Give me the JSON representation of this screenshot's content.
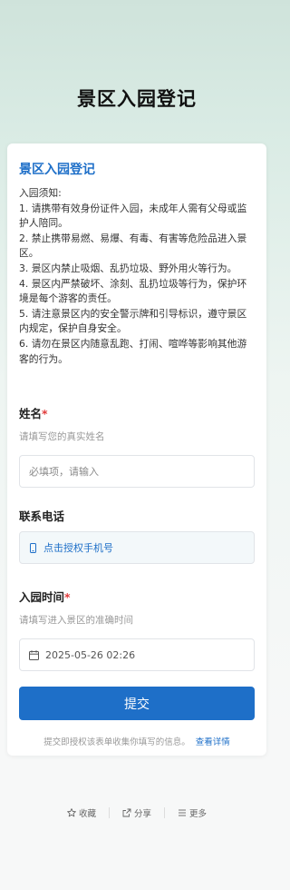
{
  "page_title": "景区入园登记",
  "card": {
    "title": "景区入园登记",
    "notice_heading": "入园须知:",
    "notice_items": [
      "1. 请携带有效身份证件入园，未成年人需有父母或监护人陪同。",
      "2. 禁止携带易燃、易爆、有毒、有害等危险品进入景区。",
      "3. 景区内禁止吸烟、乱扔垃圾、野外用火等行为。",
      "4. 景区内严禁破坏、涂刻、乱扔垃圾等行为，保护环境是每个游客的责任。",
      "5. 请注意景区内的安全警示牌和引导标识，遵守景区内规定，保护自身安全。",
      "6. 请勿在景区内随意乱跑、打闹、喧哗等影响其他游客的行为。"
    ]
  },
  "form": {
    "name": {
      "label": "姓名",
      "required_mark": "*",
      "description": "请填写您的真实姓名",
      "placeholder": "必填项，请输入",
      "value": ""
    },
    "phone": {
      "label": "联系电话",
      "button_label": "点击授权手机号",
      "icon": "phone-icon"
    },
    "entry_time": {
      "label": "入园时间",
      "required_mark": "*",
      "description": "请填写进入景区的准确时间",
      "value": "2025-05-26 02:26",
      "icon": "calendar-icon"
    },
    "submit_label": "提交",
    "consent_text": "提交即授权该表单收集你填写的信息。",
    "consent_link": "查看详情"
  },
  "footer": {
    "favorite_label": "收藏",
    "share_label": "分享",
    "more_label": "更多"
  },
  "colors": {
    "accent": "#1e6fc8",
    "required": "#e13b3b"
  }
}
